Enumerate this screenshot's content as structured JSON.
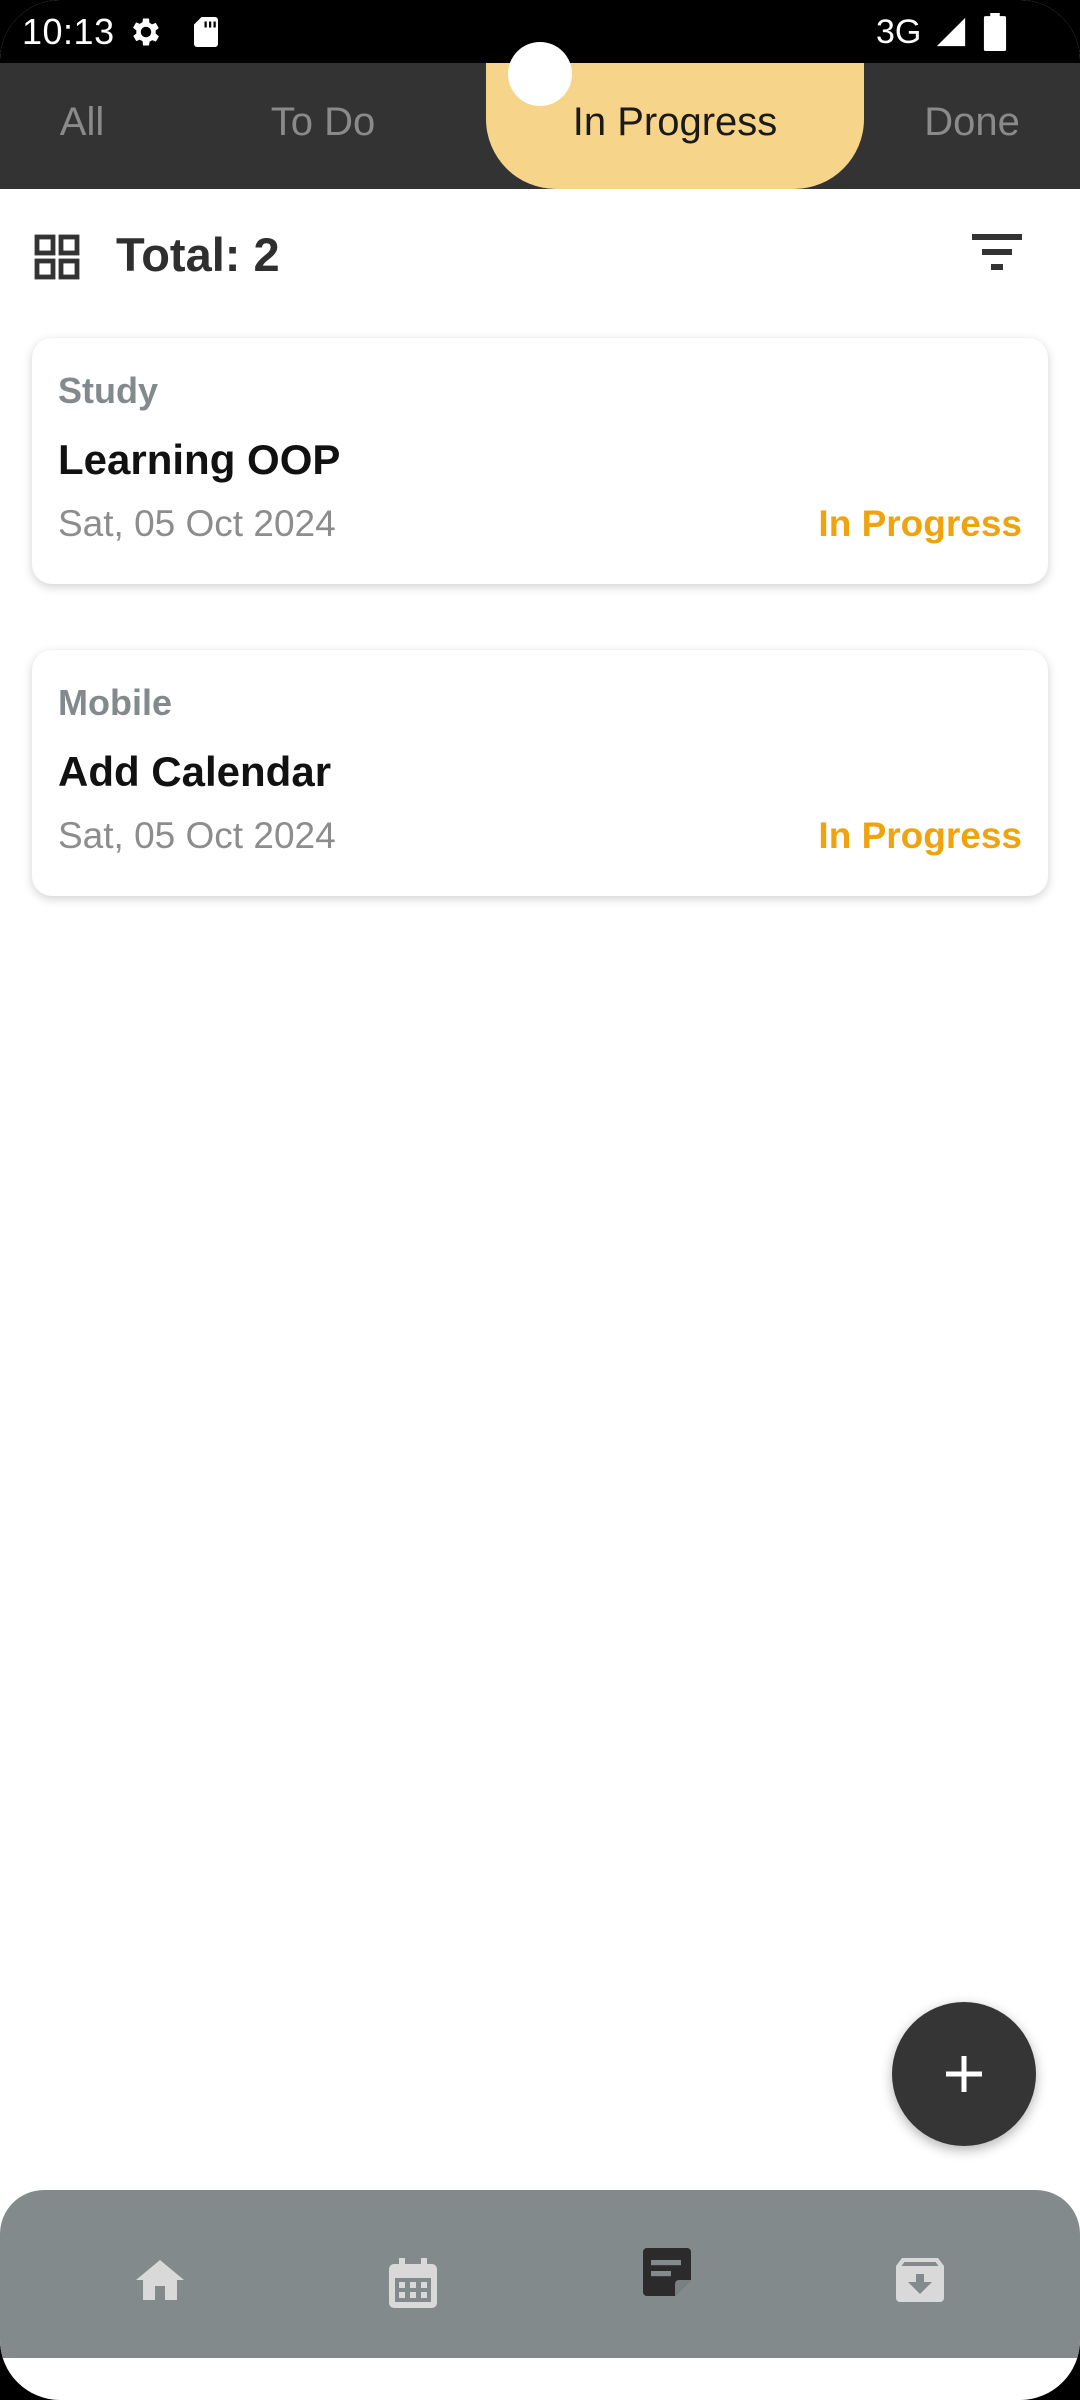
{
  "status_bar": {
    "time": "10:13",
    "network": "3G",
    "icons": [
      "settings-icon",
      "sd-card-icon",
      "signal-icon",
      "battery-icon"
    ]
  },
  "tabs": [
    {
      "label": "All",
      "active": false
    },
    {
      "label": "To Do",
      "active": false
    },
    {
      "label": "In Progress",
      "active": true
    },
    {
      "label": "Done",
      "active": false
    }
  ],
  "header": {
    "total_label": "Total: 2"
  },
  "tasks": [
    {
      "category": "Study",
      "title": "Learning OOP",
      "date": "Sat, 05 Oct 2024",
      "status": "In Progress"
    },
    {
      "category": "Mobile",
      "title": "Add Calendar",
      "date": "Sat, 05 Oct 2024",
      "status": "In Progress"
    }
  ],
  "bottom_nav": {
    "items": [
      "home-icon",
      "calendar-icon",
      "notes-icon",
      "archive-icon"
    ],
    "active_index": 2
  },
  "colors": {
    "tab_bar_bg": "#333333",
    "tab_active_bg": "#f6d58b",
    "status_in_progress": "#efa30f",
    "bottom_nav_bg": "#838a8b",
    "fab_bg": "#353535"
  }
}
